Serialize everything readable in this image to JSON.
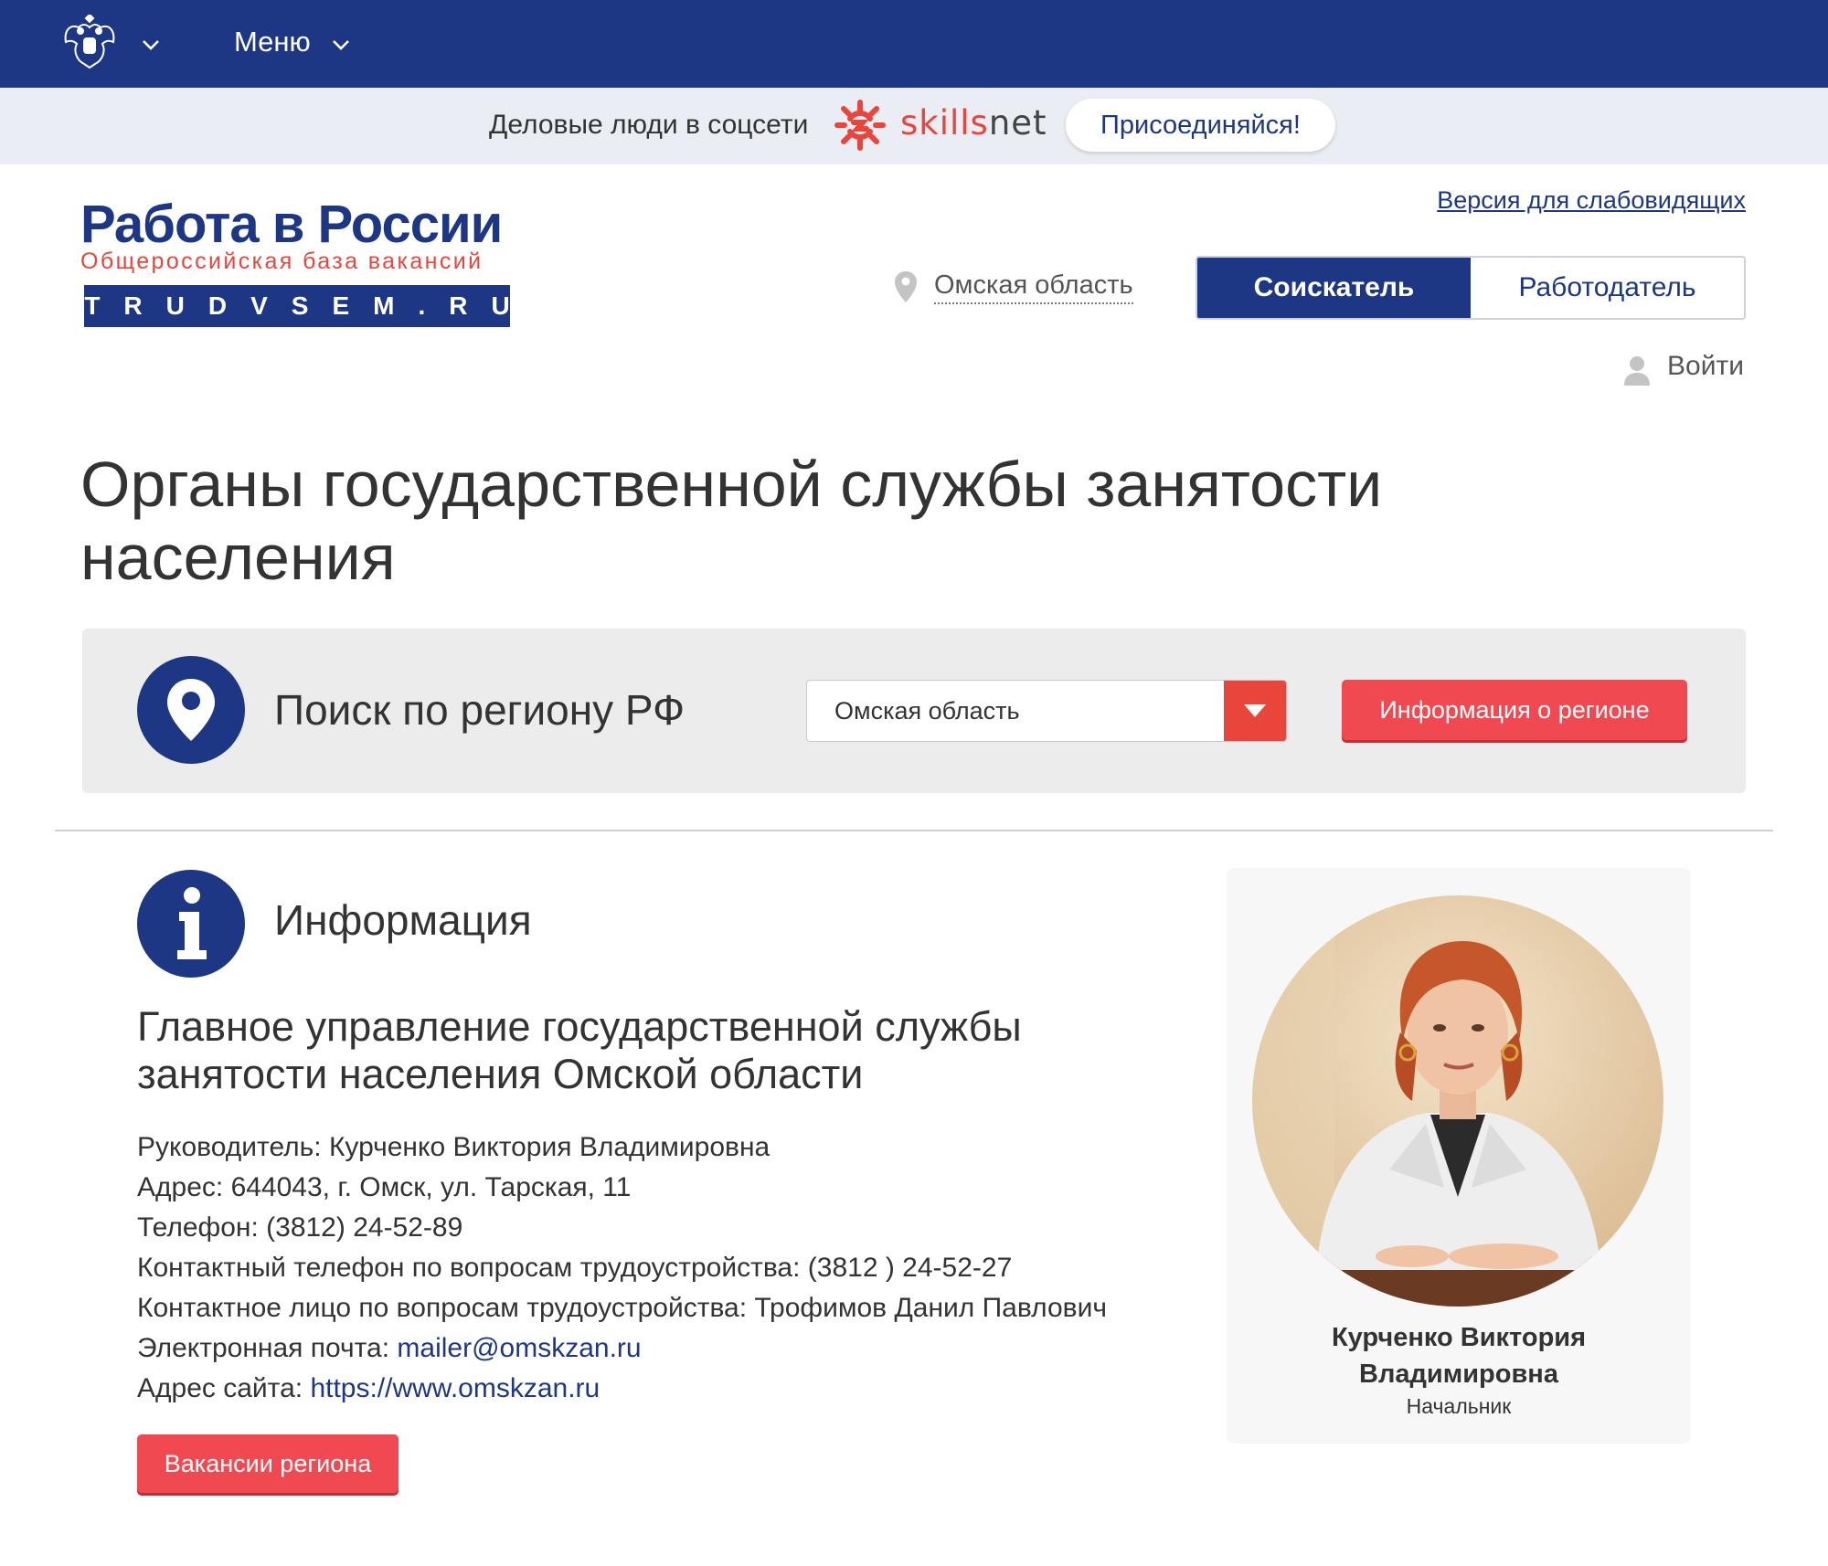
{
  "topbar": {
    "menu_label": "Меню",
    "background_color": "#1e3784",
    "emblem_icon": "coat-of-arms-icon"
  },
  "promo": {
    "text": "Деловые люди в соцсети",
    "brand_skills": "skills",
    "brand_net": "net",
    "join_label": "Присоединяйся!"
  },
  "logo": {
    "title": "Работа в России",
    "subtitle": "Общероссийская база вакансий",
    "domain": "TRUDVSEM.RU"
  },
  "header": {
    "vision_link": "Версия для слабовидящих",
    "region": "Омская область",
    "segments": [
      {
        "label": "Соискатель",
        "active": true
      },
      {
        "label": "Работодатель",
        "active": false
      }
    ],
    "login_label": "Войти"
  },
  "page": {
    "title": "Органы государственной службы занятости населения"
  },
  "search": {
    "label": "Поиск по региону РФ",
    "selected_region": "Омская область",
    "info_button": "Информация о регионе"
  },
  "info": {
    "heading": "Информация",
    "org_name": "Главное управление государственной службы занятости населения Омской области",
    "details": [
      {
        "label": "Руководитель:",
        "value": "Курченко Виктория Владимировна",
        "link": false
      },
      {
        "label": "Адрес:",
        "value": "644043, г. Омск, ул. Тарская, 11",
        "link": false
      },
      {
        "label": "Телефон:",
        "value": "(3812) 24-52-89",
        "link": false
      },
      {
        "label": "Контактный телефон по вопросам трудоустройства:",
        "value": "(3812 ) 24-52-27",
        "link": false
      },
      {
        "label": "Контактное лицо по вопросам трудоустройства:",
        "value": "Трофимов Данил Павлович",
        "link": false
      },
      {
        "label": "Электронная почта:",
        "value": "mailer@omskzan.ru",
        "link": true
      },
      {
        "label": "Адрес сайта:",
        "value": "https://www.omskzan.ru",
        "link": true
      }
    ],
    "vacancies_button": "Вакансии региона"
  },
  "profile": {
    "name_line1": "Курченко Виктория",
    "name_line2": "Владимировна",
    "role": "Начальник"
  },
  "colors": {
    "brand_blue": "#1e3784",
    "accent_red": "#f04951",
    "promo_bg": "#eaedf3",
    "panel_bg": "#ececec"
  }
}
